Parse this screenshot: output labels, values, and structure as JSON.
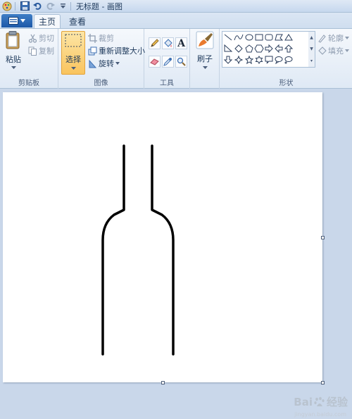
{
  "window": {
    "title": "无标题 - 画图"
  },
  "tabs": {
    "home": "主页",
    "view": "查看"
  },
  "clipboard": {
    "group_label": "剪贴板",
    "paste": "粘贴",
    "cut": "剪切",
    "copy": "复制"
  },
  "image": {
    "group_label": "图像",
    "select": "选择",
    "crop": "裁剪",
    "resize": "重新调整大小",
    "rotate": "旋转"
  },
  "tools": {
    "group_label": "工具",
    "text_tool_glyph": "A"
  },
  "brushes": {
    "label": "刷子"
  },
  "shapes": {
    "group_label": "形状",
    "outline": "轮廓",
    "fill": "填充"
  },
  "watermark": {
    "brand": "Bai",
    "brand_suffix": "经验",
    "sub": "jingyan.baidu.com"
  },
  "colors": {
    "accent": "#1d58a8",
    "stroke": "#000000",
    "highlight": "#f9c45e"
  }
}
